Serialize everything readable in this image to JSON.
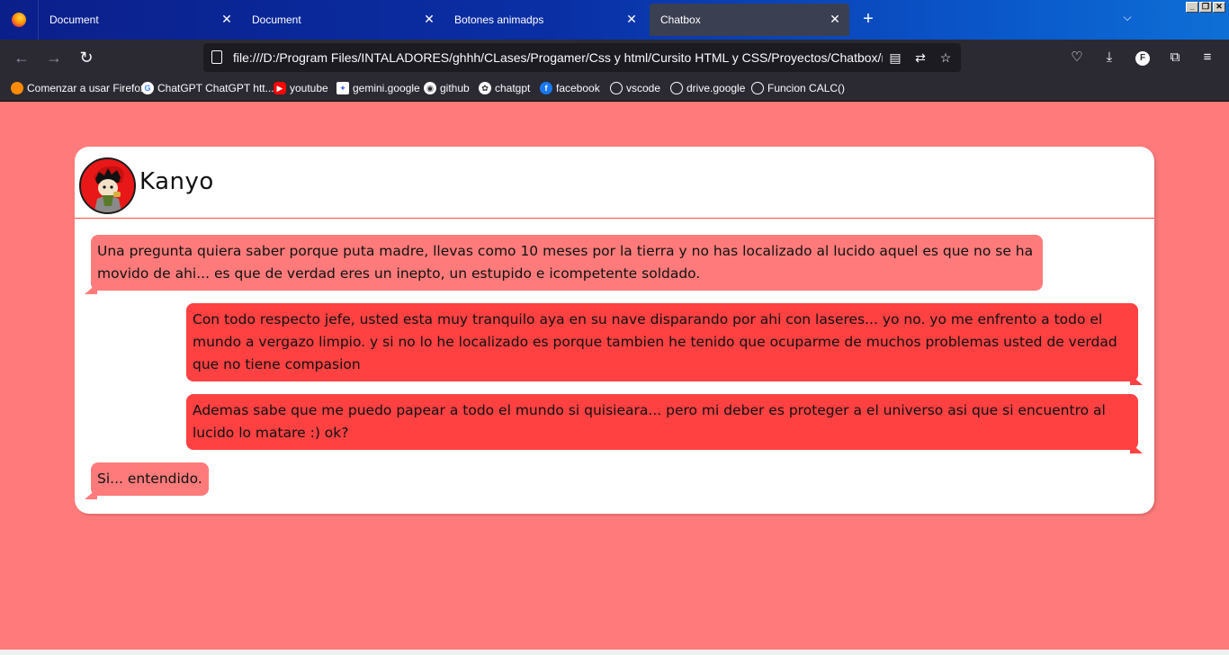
{
  "browser": {
    "tabs": [
      {
        "title": "Document"
      },
      {
        "title": "Document"
      },
      {
        "title": "Botones animadps"
      },
      {
        "title": "Chatbox"
      }
    ],
    "active_tab_index": 3,
    "url": "file:///D:/Program Files/INTALADORES/ghhh/CLases/Progamer/Css y html/Cursito HTML y CSS/Proyectos/Chatbox/main.html",
    "profile_initial": "F",
    "bookmarks": [
      {
        "label": "Comenzar a usar Firefox",
        "icon": "firefox-icon"
      },
      {
        "label": "ChatGPT ChatGPT htt...",
        "icon": "google-icon"
      },
      {
        "label": "youtube",
        "icon": "youtube-icon"
      },
      {
        "label": "gemini.google",
        "icon": "gemini-icon"
      },
      {
        "label": "github",
        "icon": "github-icon"
      },
      {
        "label": "chatgpt",
        "icon": "chatgpt-icon"
      },
      {
        "label": "facebook",
        "icon": "facebook-icon"
      },
      {
        "label": "vscode",
        "icon": "globe-icon"
      },
      {
        "label": "drive.google",
        "icon": "globe-icon"
      },
      {
        "label": "Funcion CALC()",
        "icon": "globe-icon"
      }
    ]
  },
  "chat": {
    "contact_name": "Kanyo",
    "messages": [
      {
        "side": "received",
        "text": "Una pregunta quiera saber porque puta madre, llevas como 10 meses por la tierra y no has localizado al lucido aquel es que no se ha movido de ahi... es que de verdad eres un inepto, un estupido e icompetente soldado."
      },
      {
        "side": "sent",
        "text": "Con todo respecto jefe, usted esta muy tranquilo aya en su nave disparando por ahi con laseres... yo no. yo me enfrento a todo el mundo a vergazo limpio. y si no lo he localizado es porque tambien he tenido que ocuparme de muchos problemas usted de verdad que no tiene compasion"
      },
      {
        "side": "sent",
        "text": "Ademas sabe que me puedo papear a todo el mundo si quisieara... pero mi deber es proteger a el universo asi que si encuentro al lucido lo matare :) ok?"
      },
      {
        "side": "received",
        "text": "Si... entendido."
      }
    ]
  },
  "colors": {
    "page_background": "#ff7b7b",
    "received_bubble": "#ff7b7b",
    "sent_bubble": "#ff4142",
    "header_divider": "#ff4545"
  }
}
